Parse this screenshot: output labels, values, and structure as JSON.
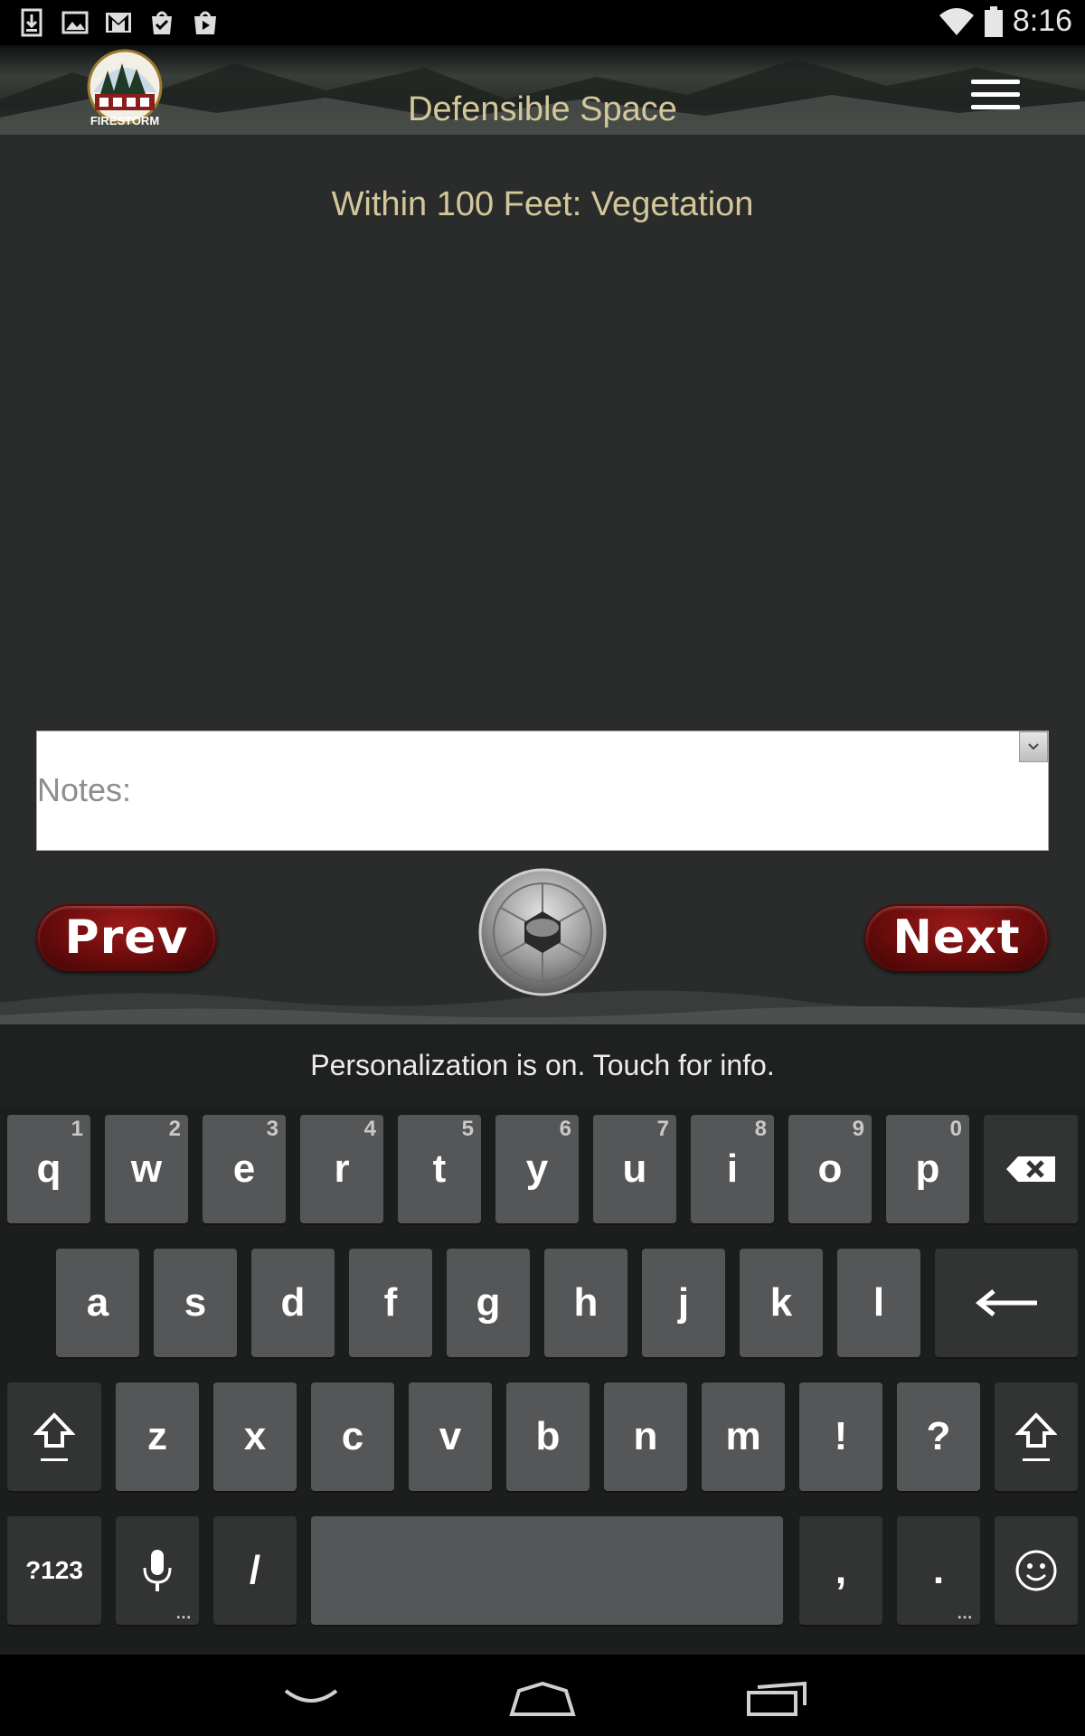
{
  "status_bar": {
    "time": "8:16",
    "icons_left": [
      "download-icon",
      "image-icon",
      "gmail-icon",
      "tasks-icon",
      "shopping-bag-icon"
    ],
    "icons_right": [
      "wifi-icon",
      "battery-icon"
    ]
  },
  "header": {
    "title": "Defensible Space",
    "logo_text": "FIRESTORM",
    "menu_icon": "hamburger-menu-icon"
  },
  "main": {
    "heading": "Within 100 Feet: Vegetation",
    "notes": {
      "placeholder": "Notes:",
      "value": ""
    },
    "prev_label": "Prev",
    "next_label": "Next",
    "camera_icon": "camera-aperture-icon"
  },
  "keyboard": {
    "suggestion_text": "Personalization is on. Touch for info.",
    "row1": [
      {
        "key": "q",
        "hint": "1"
      },
      {
        "key": "w",
        "hint": "2"
      },
      {
        "key": "e",
        "hint": "3"
      },
      {
        "key": "r",
        "hint": "4"
      },
      {
        "key": "t",
        "hint": "5"
      },
      {
        "key": "y",
        "hint": "6"
      },
      {
        "key": "u",
        "hint": "7"
      },
      {
        "key": "i",
        "hint": "8"
      },
      {
        "key": "o",
        "hint": "9"
      },
      {
        "key": "p",
        "hint": "0"
      }
    ],
    "row2": [
      "a",
      "s",
      "d",
      "f",
      "g",
      "h",
      "j",
      "k",
      "l"
    ],
    "row3": [
      "z",
      "x",
      "c",
      "v",
      "b",
      "n",
      "m",
      "!",
      "?"
    ],
    "row4": {
      "symbols_label": "?123",
      "slash": "/",
      "comma": ",",
      "period": "."
    },
    "colors": {
      "key": "#555657",
      "dark_key": "#323333",
      "background": "#1c1d1d"
    }
  },
  "nav_bar": {
    "icons": [
      "back-icon",
      "home-icon",
      "recent-apps-icon"
    ]
  },
  "colors": {
    "accent_text": "#d3c79a",
    "button_red": "#7a0f0f",
    "content_bg": "#2a2c2b"
  }
}
